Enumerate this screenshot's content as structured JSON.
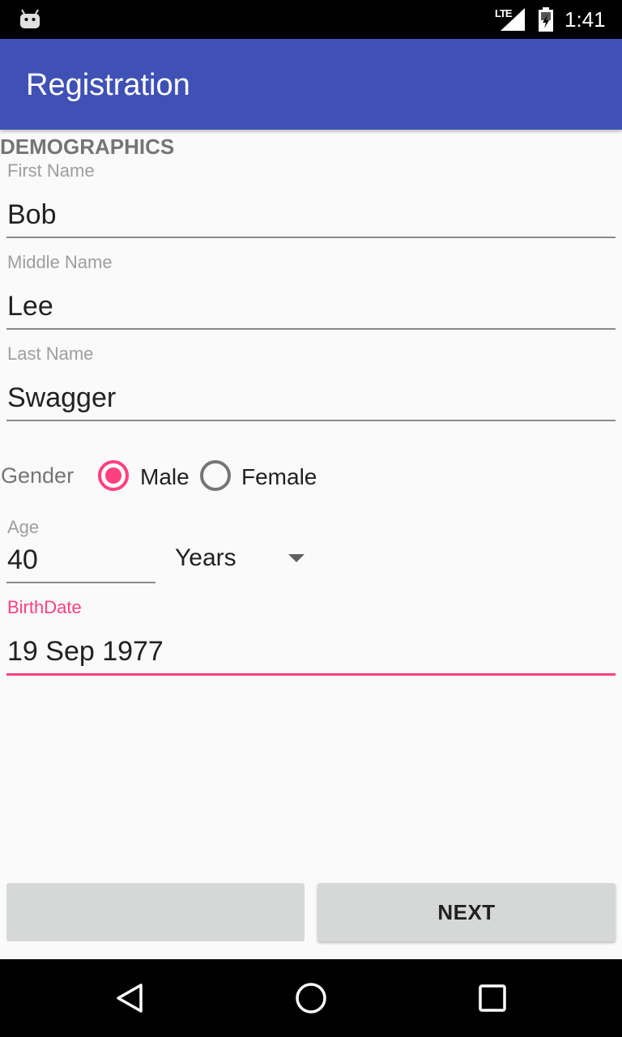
{
  "status_bar": {
    "network": "LTE",
    "time": "1:41",
    "icons": [
      "android-icon",
      "signal-icon",
      "battery-icon"
    ]
  },
  "app_bar": {
    "title": "Registration"
  },
  "form": {
    "section_title": "DEMOGRAPHICS",
    "first_name": {
      "label": "First Name",
      "value": "Bob"
    },
    "middle_name": {
      "label": "Middle Name",
      "value": "Lee"
    },
    "last_name": {
      "label": "Last Name",
      "value": "Swagger"
    },
    "gender": {
      "label": "Gender",
      "options": [
        {
          "label": "Male",
          "selected": true
        },
        {
          "label": "Female",
          "selected": false
        }
      ]
    },
    "age": {
      "label": "Age",
      "value": "40",
      "unit_selected": "Years"
    },
    "birthdate": {
      "label": "BirthDate",
      "value": "19 Sep 1977",
      "focused": true
    }
  },
  "buttons": {
    "previous_label": "",
    "next_label": "NEXT"
  },
  "nav_bar": {
    "icons": [
      "back-icon",
      "home-icon",
      "recents-icon"
    ]
  },
  "colors": {
    "primary": "#3f51b5",
    "accent": "#ff4081",
    "status_bar": "#000000",
    "button_bg": "#d6d7d7"
  }
}
